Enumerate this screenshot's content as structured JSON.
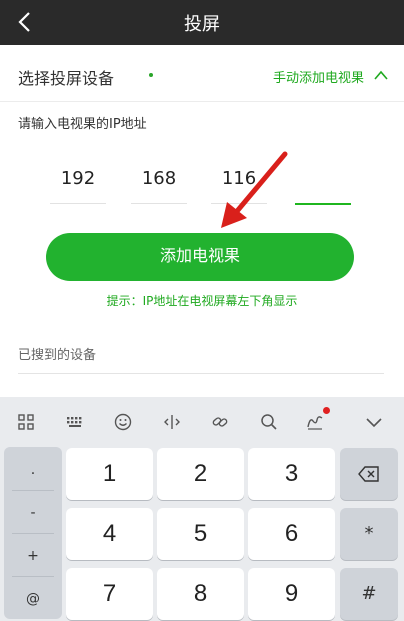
{
  "header": {
    "title": "投屏"
  },
  "device_select": {
    "label": "选择投屏设备",
    "manual_add": "手动添加电视果"
  },
  "ip_form": {
    "prompt": "请输入电视果的IP地址",
    "segments": [
      "192",
      "168",
      "116",
      ""
    ],
    "add_button": "添加电视果",
    "hint": "提示：IP地址在电视屏幕左下角显示"
  },
  "found_devices": {
    "label": "已搜到的设备"
  },
  "keyboard": {
    "toolbar_icons": [
      "grid-icon",
      "keyboard-icon",
      "emoji-icon",
      "cursor-icon",
      "link-icon",
      "search-icon",
      "handwrite-icon",
      "collapse-icon"
    ],
    "symbols": [
      ".",
      "-",
      "+",
      "@"
    ],
    "digits": [
      "1",
      "2",
      "3",
      "4",
      "5",
      "6",
      "7",
      "8",
      "9"
    ],
    "right_keys": [
      "",
      "*",
      "#"
    ]
  },
  "colors": {
    "accent": "#22b22f",
    "header_bg": "#2a2a2a",
    "keyboard_bg": "#e9ebee"
  }
}
